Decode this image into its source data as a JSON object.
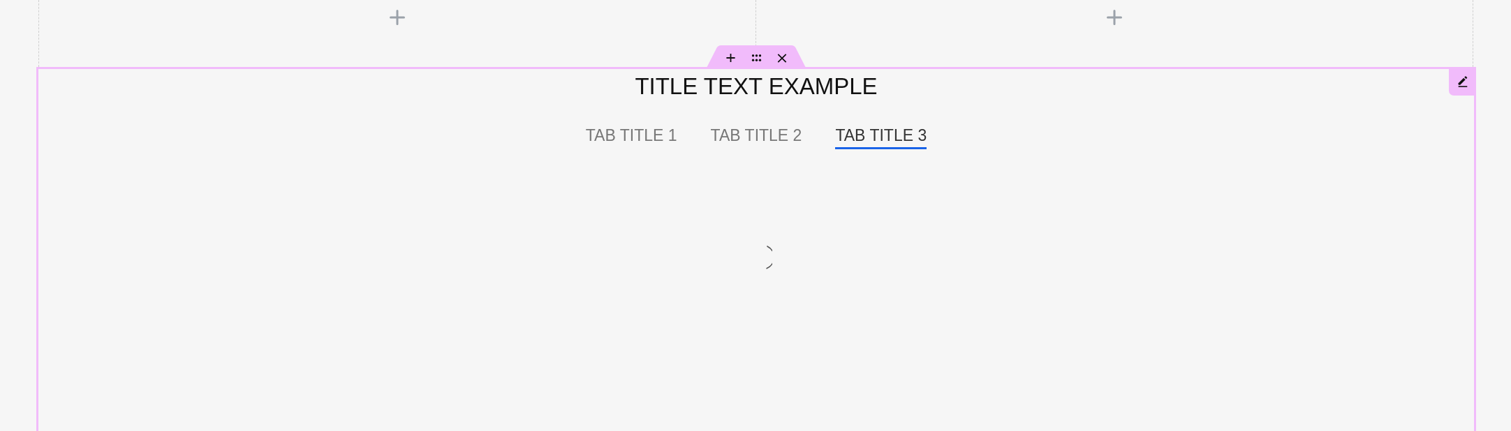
{
  "add_slots": [
    {
      "kind": "add"
    },
    {
      "kind": "add"
    }
  ],
  "block": {
    "selected": true,
    "title": "TITLE TEXT EXAMPLE",
    "tabs": [
      {
        "label": "TAB TITLE 1",
        "selected": false
      },
      {
        "label": "TAB TITLE 2",
        "selected": false
      },
      {
        "label": "TAB TITLE 3",
        "selected": true
      }
    ],
    "loading": true
  }
}
